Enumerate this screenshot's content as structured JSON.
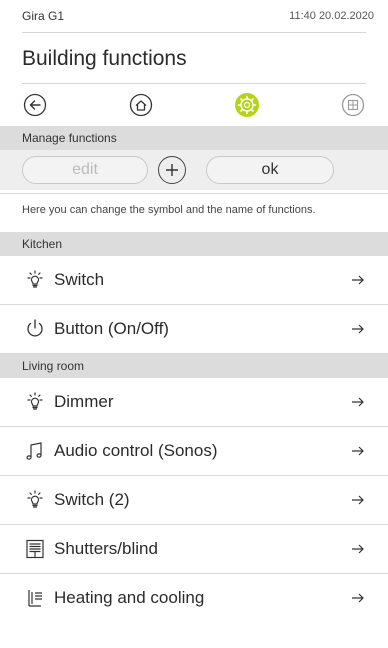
{
  "status": {
    "device": "Gira G1",
    "clock": "11:40 20.02.2020"
  },
  "page": {
    "title": "Building functions"
  },
  "nav": {
    "icons": [
      "back-arrow-icon",
      "home-icon",
      "settings-gear-icon",
      "grid-icon"
    ],
    "accent_color": "#b5d318"
  },
  "manage": {
    "header": "Manage functions",
    "edit_label": "edit",
    "ok_label": "ok",
    "hint": "Here you can change the symbol and the name of functions."
  },
  "groups": [
    {
      "name": "Kitchen",
      "items": [
        {
          "label": "Switch",
          "icon": "bulb-icon"
        },
        {
          "label": "Button (On/Off)",
          "icon": "power-icon"
        }
      ]
    },
    {
      "name": "Living room",
      "items": [
        {
          "label": "Dimmer",
          "icon": "bulb-icon"
        },
        {
          "label": "Audio control (Sonos)",
          "icon": "music-note-icon"
        },
        {
          "label": "Switch (2)",
          "icon": "bulb-icon"
        },
        {
          "label": "Shutters/blind",
          "icon": "shutter-icon"
        },
        {
          "label": "Heating and cooling",
          "icon": "radiator-icon"
        }
      ]
    }
  ]
}
